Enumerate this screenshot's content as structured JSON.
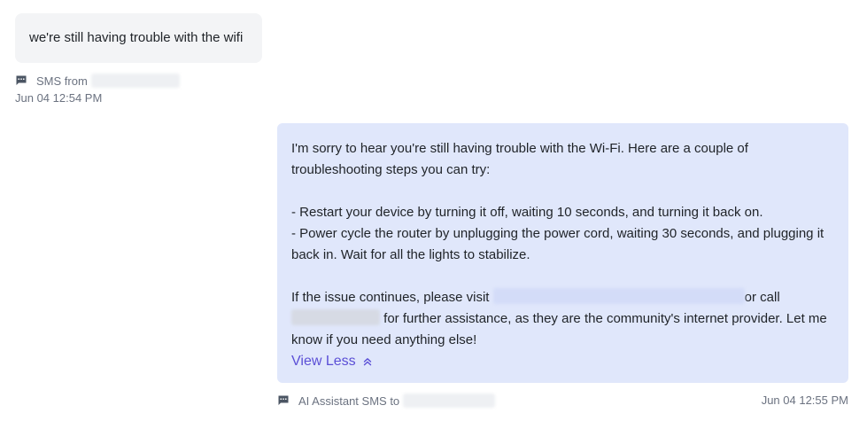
{
  "incoming": {
    "text": "we're still having trouble with the wifi",
    "meta_label": "SMS from",
    "timestamp": "Jun 04 12:54 PM"
  },
  "outgoing": {
    "para1_line1": "I'm sorry to hear you're still having trouble with the Wi-Fi. Here are a couple of",
    "para1_line2": "troubleshooting steps you can try:",
    "step1": "- Restart your device by turning it off, waiting 10 seconds, and turning it back on.",
    "step2_line1": "- Power cycle the router by unplugging the power cord, waiting 30 seconds, and plugging it",
    "step2_line2": "back in. Wait for all the lights to stabilize.",
    "final_part1": "If the issue continues, please visit",
    "final_part2": "or call",
    "final_part3": "for further assistance, as they are the community's internet provider. Let me",
    "final_part4": "know if you need anything else!",
    "view_less_label": "View Less",
    "meta_label": "AI Assistant SMS to",
    "timestamp": "Jun 04 12:55 PM"
  },
  "icons": {
    "message": "message-square-icon",
    "chevron": "chevron-double-up-icon"
  },
  "colors": {
    "incoming_bubble": "#f3f4f6",
    "outgoing_bubble": "#e0e7fb",
    "link_accent": "#5b4fd6",
    "meta_text": "#6b7280"
  }
}
